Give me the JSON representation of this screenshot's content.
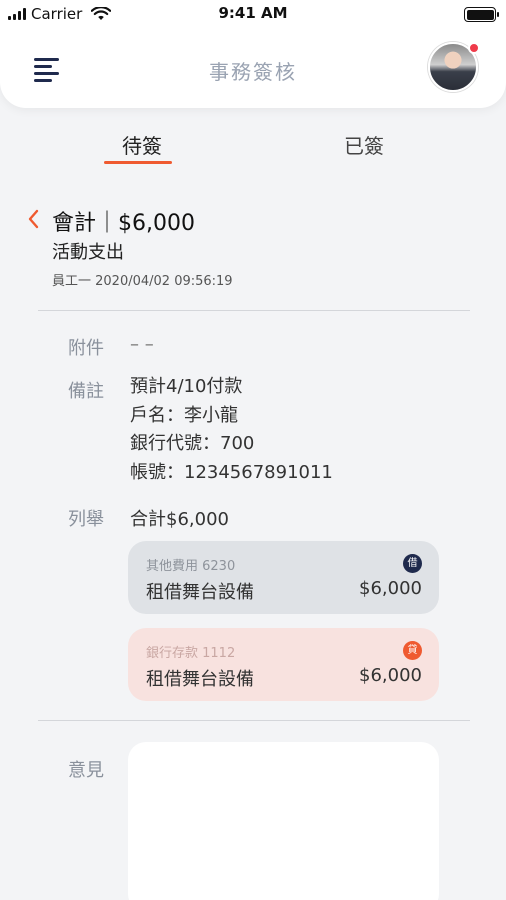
{
  "status_bar": {
    "carrier": "Carrier",
    "time": "9:41 AM"
  },
  "header": {
    "title": "事務簽核"
  },
  "tabs": [
    {
      "label": "待簽"
    },
    {
      "label": "已簽"
    }
  ],
  "detail": {
    "title": "會計｜$6,000",
    "subtitle": "活動支出",
    "meta": "員工一 2020/04/02 09:56:19"
  },
  "attachment": {
    "label": "附件",
    "value": "– –"
  },
  "notes": {
    "label": "備註",
    "lines": [
      "預計4/10付款",
      "戶名：李小龍",
      "銀行代號：700",
      "帳號：1234567891011"
    ]
  },
  "items": {
    "label": "列舉",
    "total": "合計$6,000",
    "entries": [
      {
        "code": "其他費用 6230",
        "name": "租借舞台設備",
        "amount": "$6,000",
        "badge": "借",
        "color": "#1f2a4d"
      },
      {
        "code": "銀行存款 1112",
        "name": "租借舞台設備",
        "amount": "$6,000",
        "badge": "貸",
        "color": "#ef5a30"
      }
    ]
  },
  "comment": {
    "label": "意見",
    "placeholder": ""
  },
  "colors": {
    "accent": "#ef5a30",
    "navy": "#1f2a4d",
    "notification": "#ef3b4a"
  }
}
